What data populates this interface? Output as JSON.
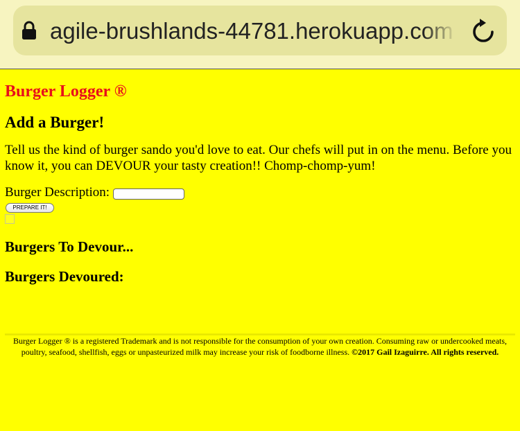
{
  "browser": {
    "url": "agile-brushlands-44781.herokuapp.com",
    "lock_icon": "lock-icon",
    "reload_icon": "reload-icon"
  },
  "page": {
    "title": "Burger Logger ®",
    "add_heading": "Add a Burger!",
    "intro": "Tell us the kind of burger sando you'd love to eat. Our chefs will put in on the menu. Before you know it, you can DEVOUR your tasty creation!! Chomp-chomp-yum!",
    "form": {
      "description_label": "Burger Description:",
      "description_value": "",
      "submit_label": "PREPARE IT!"
    },
    "to_devour_heading": "Burgers To Devour...",
    "devoured_heading": "Burgers Devoured:"
  },
  "footer": {
    "notice": "Burger Logger ® is a registered Trademark and is not responsible for the consumption of your own creation. Consuming raw or undercooked meats, poultry, seafood, shellfish, eggs or unpasteurized milk may increase your risk of foodborne illness.",
    "copyright": "©2017 Gail Izaguirre. All rights reserved."
  },
  "colors": {
    "page_background": "#ffff00",
    "title": "#e8101a",
    "browser_bar": "#f7f4c0",
    "url_pill": "#e6e49e"
  }
}
